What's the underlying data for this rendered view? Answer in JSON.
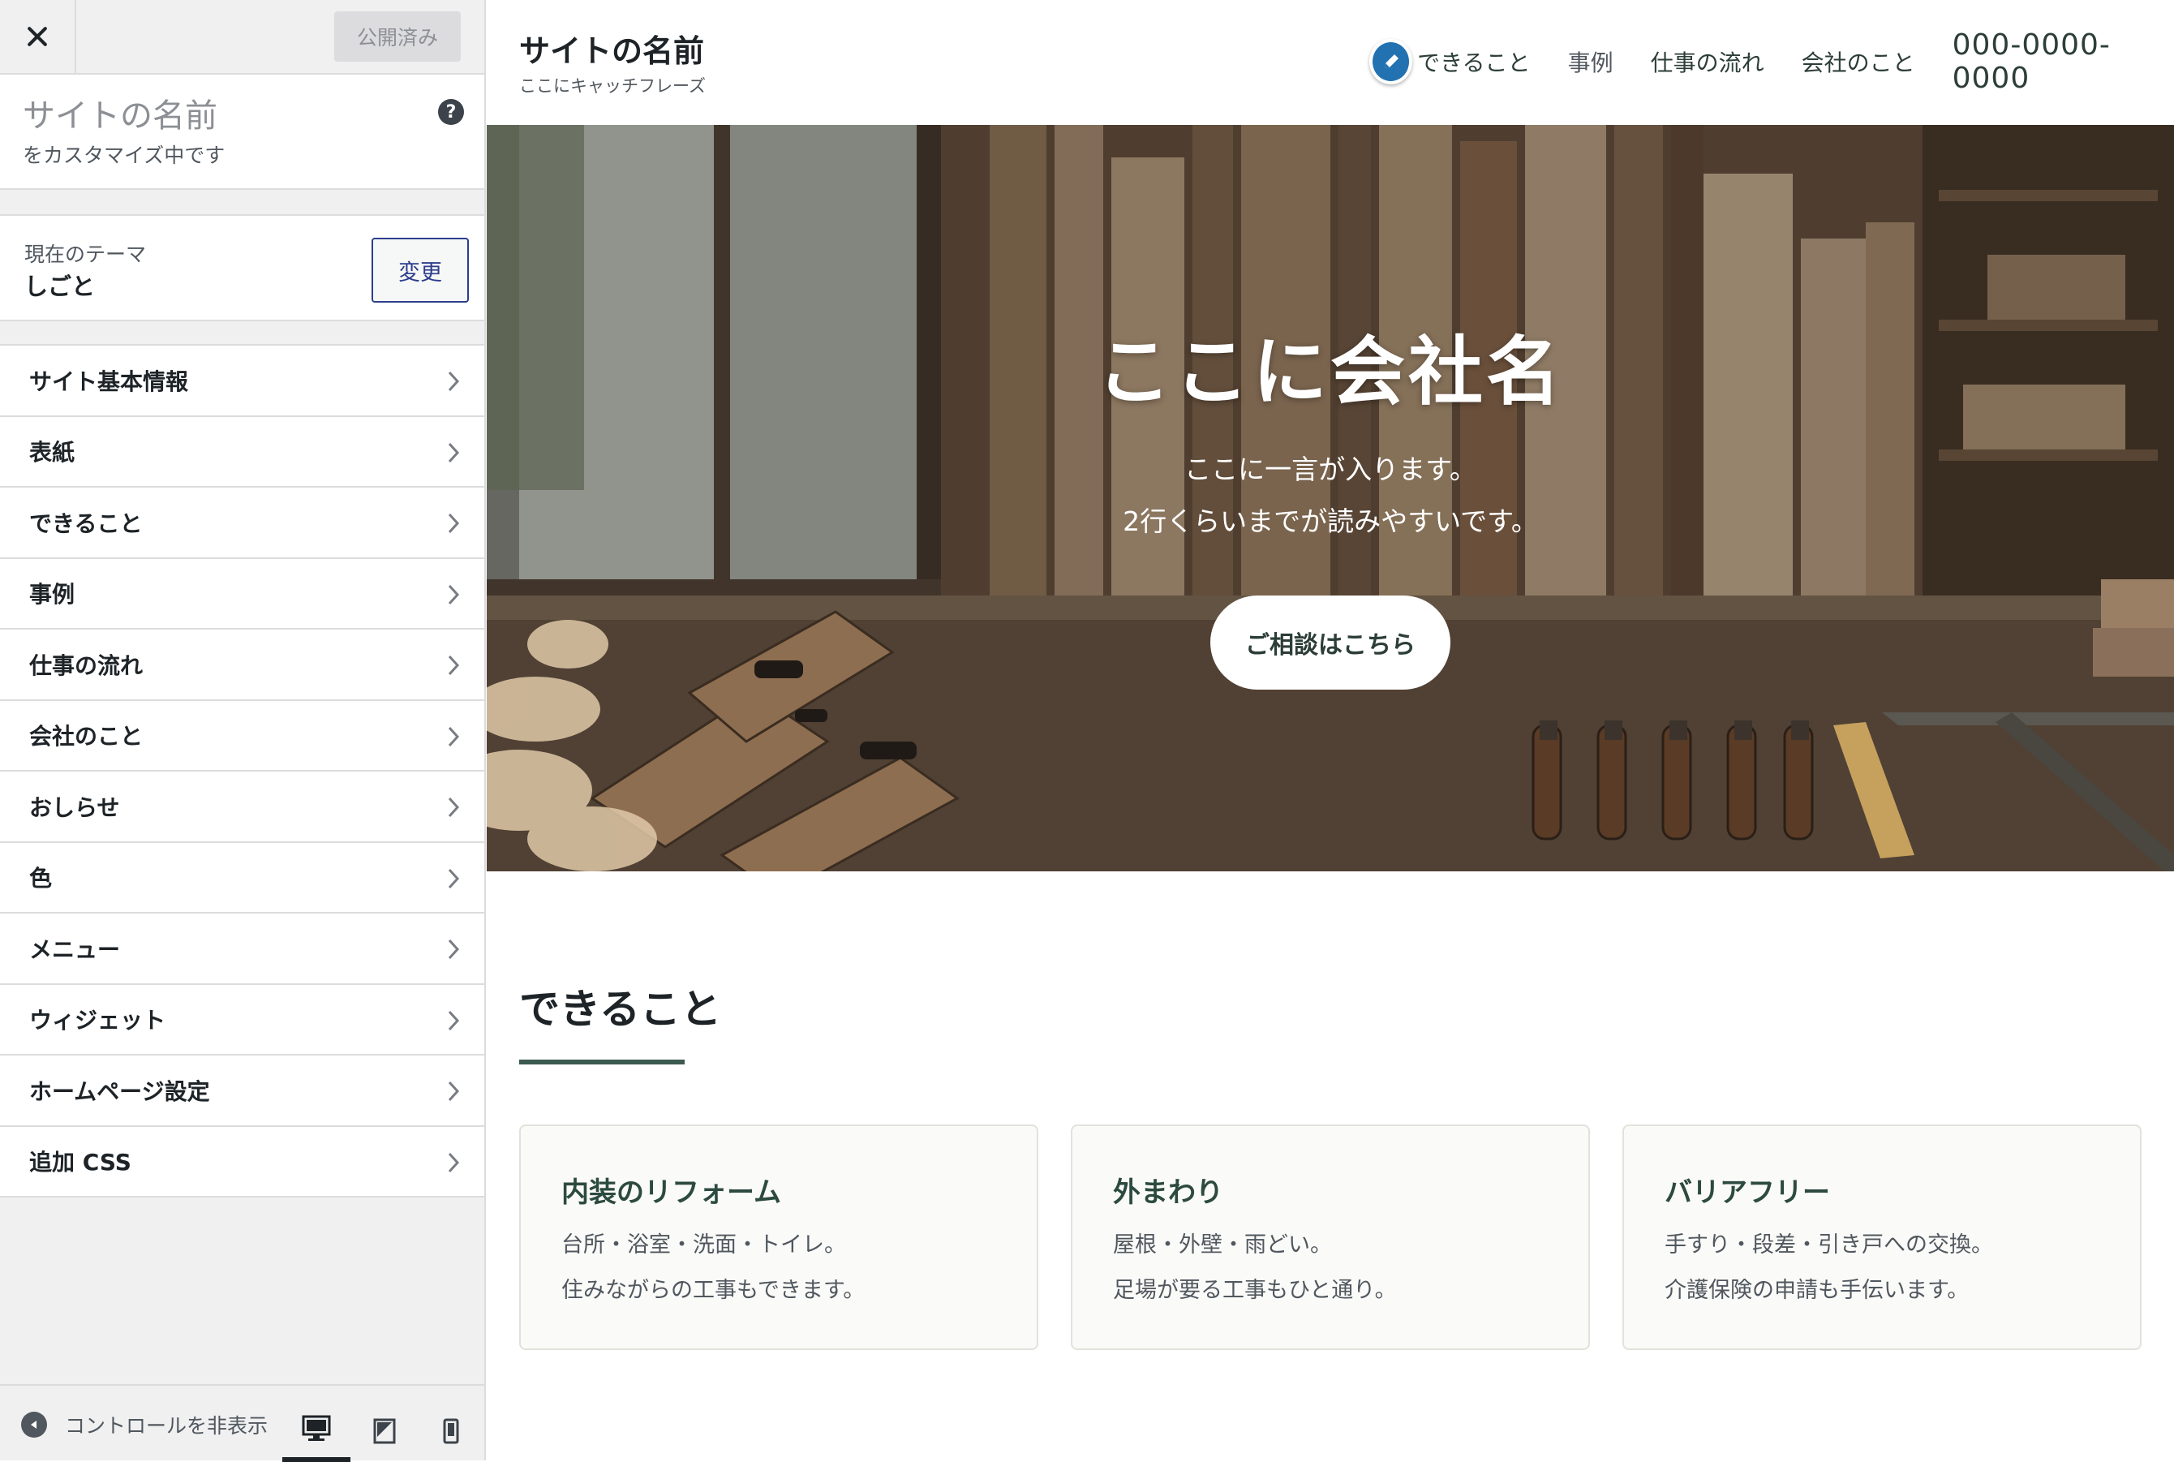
{
  "customizer": {
    "publish_label": "公開済み",
    "site_name": "サイトの名前",
    "customizing_label": "をカスタマイズ中です",
    "theme": {
      "label": "現在のテーマ",
      "name": "しごと",
      "change_label": "変更"
    },
    "sections": [
      {
        "label": "サイト基本情報"
      },
      {
        "label": "表紙"
      },
      {
        "label": "できること"
      },
      {
        "label": "事例"
      },
      {
        "label": "仕事の流れ"
      },
      {
        "label": "会社のこと"
      },
      {
        "label": "おしらせ"
      },
      {
        "label": "色"
      },
      {
        "label": "メニュー"
      },
      {
        "label": "ウィジェット"
      },
      {
        "label": "ホームページ設定"
      },
      {
        "label": "追加 CSS"
      }
    ],
    "footer": {
      "collapse_label": "コントロールを非表示"
    }
  },
  "site": {
    "title": "サイトの名前",
    "tagline": "ここにキャッチフレーズ",
    "nav": {
      "items": [
        "できること",
        "事例",
        "仕事の流れ",
        "会社のこと"
      ],
      "phone": "000-0000-0000"
    },
    "hero": {
      "title": "ここに会社名",
      "line1": "ここに一言が入ります。",
      "line2": "2行くらいまでが読みやすいです。",
      "cta": "ご相談はこちら"
    },
    "services": {
      "heading": "できること",
      "cards": [
        {
          "title": "内装のリフォーム",
          "line1": "台所・浴室・洗面・トイレ。",
          "line2": "住みながらの工事もできます。"
        },
        {
          "title": "外まわり",
          "line1": "屋根・外壁・雨どい。",
          "line2": "足場が要る工事もひと通り。"
        },
        {
          "title": "バリアフリー",
          "line1": "手すり・段差・引き戸への交換。",
          "line2": "介護保険の申請も手伝います。"
        }
      ]
    }
  },
  "colors": {
    "accent": "#2271b1",
    "brand_green": "#3c5a4f",
    "button_border": "#2c3e8c"
  }
}
